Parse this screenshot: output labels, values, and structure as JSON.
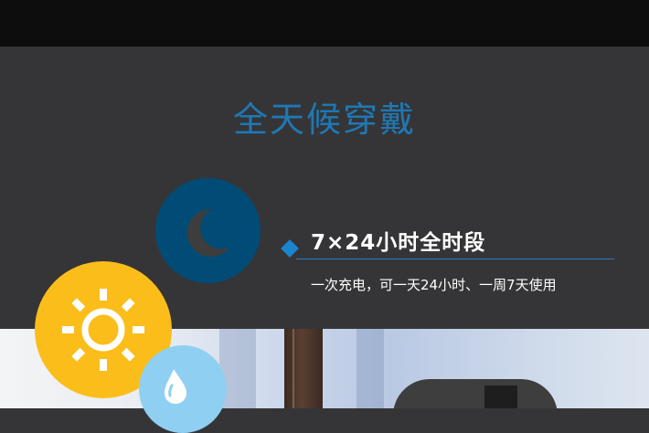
{
  "title": "全天候穿戴",
  "feature": {
    "heading": "7×24小时全时段",
    "description": "一次充电，可一天24小时、一周7天使用"
  },
  "icons": {
    "moon": "moon-icon",
    "sun": "sun-icon",
    "water": "water-drop-icon",
    "bullet": "diamond-bullet-icon"
  },
  "colors": {
    "title": "#1f78b4",
    "moon_circle": "#004c77",
    "sun_circle": "#fbbd1a",
    "drop_circle": "#8fd0f2",
    "accent": "#1a84cc",
    "background": "#353537"
  }
}
